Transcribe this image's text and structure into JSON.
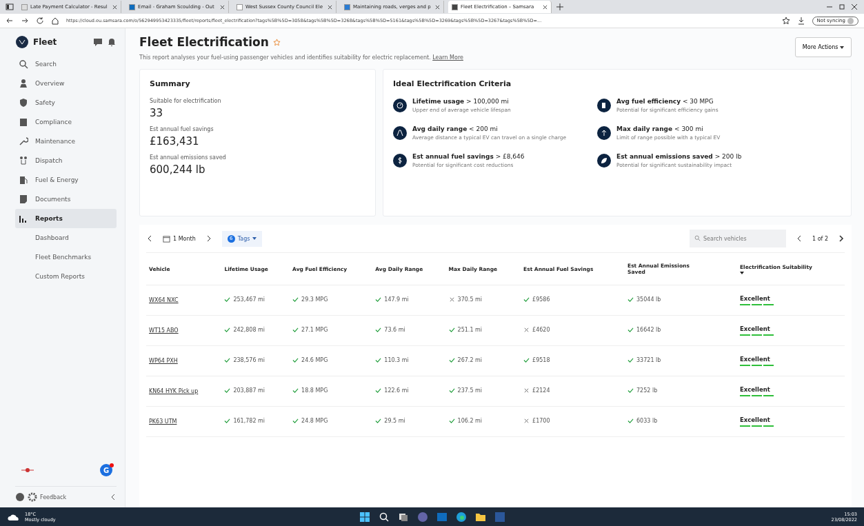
{
  "browser": {
    "tabs": [
      {
        "label": "Late Payment Calculator - Resul",
        "selected": false
      },
      {
        "label": "Email - Graham Scoulding - Out",
        "selected": false
      },
      {
        "label": "West Sussex County Council Ele",
        "selected": false
      },
      {
        "label": "Maintaining roads, verges and p",
        "selected": false
      },
      {
        "label": "Fleet Electrification – Samsara",
        "selected": true
      }
    ],
    "url": "https://cloud.eu.samsara.com/o/562949953423335/fleet/reports/fleet_electrification?tags%5B%5D=3058&tags%5B%5D=3268&tags%5B%5D=5161&tags%5B%5D=3269&tags%5B%5D=3267&tags%5B%5D=...",
    "sync": "Not syncing"
  },
  "sidebar": {
    "title": "Fleet",
    "items": [
      {
        "label": "Search",
        "selected": false
      },
      {
        "label": "Overview",
        "selected": false
      },
      {
        "label": "Safety",
        "selected": false
      },
      {
        "label": "Compliance",
        "selected": false
      },
      {
        "label": "Maintenance",
        "selected": false
      },
      {
        "label": "Dispatch",
        "selected": false
      },
      {
        "label": "Fuel & Energy",
        "selected": false
      },
      {
        "label": "Documents",
        "selected": false
      },
      {
        "label": "Reports",
        "selected": true
      }
    ],
    "subitems": [
      "Dashboard",
      "Fleet Benchmarks",
      "Custom Reports"
    ],
    "avatar": "G",
    "feedback": "Feedback"
  },
  "page": {
    "title": "Fleet Electrification",
    "description": "This report analyses your fuel-using passenger vehicles and identifies suitability for electric replacement.",
    "learn_more": "Learn More",
    "more_actions": "More Actions"
  },
  "summary": {
    "title": "Summary",
    "stats": [
      {
        "label": "Suitable for electrification",
        "value": "33"
      },
      {
        "label": "Est annual fuel savings",
        "value": "£163,431"
      },
      {
        "label": "Est annual emissions saved",
        "value": "600,244 lb"
      }
    ]
  },
  "criteria": {
    "title": "Ideal Electrification Criteria",
    "items": [
      {
        "title": "**Lifetime usage** > 100,000 mi",
        "note": "Upper end of average vehicle lifespan"
      },
      {
        "title": "**Avg fuel efficiency** < 30 MPG",
        "note": "Potential for significant efficiency gains"
      },
      {
        "title": "**Avg daily range** < 200 mi",
        "note": "Average distance a typical EV can travel on a single charge"
      },
      {
        "title": "**Max daily range** < 300 mi",
        "note": "Limit of range possible with a typical EV"
      },
      {
        "title": "**Est annual fuel savings** > £8,646",
        "note": "Potential for significant cost reductions"
      },
      {
        "title": "**Est annual emissions saved** > 200 lb",
        "note": "Potential for significant sustainability impact"
      }
    ]
  },
  "toolbar": {
    "period": "1 Month",
    "tag_count": "6",
    "tags": "Tags",
    "search_placeholder": "Search vehicles",
    "page": "1 of 2"
  },
  "table": {
    "columns": [
      "Vehicle",
      "Lifetime Usage",
      "Avg Fuel Efficiency",
      "Avg Daily Range",
      "Max Daily Range",
      "Est Annual Fuel Savings",
      "Est Annual Emissions Saved",
      "Electrification Suitability"
    ],
    "rows": [
      {
        "cells": [
          {
            "kind": "link",
            "text": "WX64 NXC"
          },
          {
            "text": "253,467 mi",
            "pass": true
          },
          {
            "text": "29.3 MPG",
            "pass": true
          },
          {
            "text": "147.9 mi",
            "pass": true
          },
          {
            "text": "370.5 mi",
            "pass": false
          },
          {
            "text": "£9586",
            "pass": true
          },
          {
            "text": "35044 lb",
            "pass": true
          }
        ],
        "suitability": "Excellent",
        "stars": 3
      },
      {
        "cells": [
          {
            "kind": "link",
            "text": "WT15 ABO"
          },
          {
            "text": "242,808 mi",
            "pass": true
          },
          {
            "text": "27.1 MPG",
            "pass": true
          },
          {
            "text": "73.6 mi",
            "pass": true
          },
          {
            "text": "251.1 mi",
            "pass": true
          },
          {
            "text": "£4620",
            "pass": false
          },
          {
            "text": "16642 lb",
            "pass": true
          }
        ],
        "suitability": "Excellent",
        "stars": 3
      },
      {
        "cells": [
          {
            "kind": "link",
            "text": "WP64 PXH"
          },
          {
            "text": "238,576 mi",
            "pass": true
          },
          {
            "text": "24.6 MPG",
            "pass": true
          },
          {
            "text": "110.3 mi",
            "pass": true
          },
          {
            "text": "267.2 mi",
            "pass": true
          },
          {
            "text": "£9518",
            "pass": true
          },
          {
            "text": "33721 lb",
            "pass": true
          }
        ],
        "suitability": "Excellent",
        "stars": 3
      },
      {
        "cells": [
          {
            "kind": "link",
            "text": "KN64 HYK Pick up"
          },
          {
            "text": "203,887 mi",
            "pass": true
          },
          {
            "text": "18.8 MPG",
            "pass": true
          },
          {
            "text": "122.6 mi",
            "pass": true
          },
          {
            "text": "237.5 mi",
            "pass": true
          },
          {
            "text": "£2124",
            "pass": false
          },
          {
            "text": "7252 lb",
            "pass": true
          }
        ],
        "suitability": "Excellent",
        "stars": 3
      },
      {
        "cells": [
          {
            "kind": "link",
            "text": "PK63 UTM"
          },
          {
            "text": "161,782 mi",
            "pass": true
          },
          {
            "text": "24.8 MPG",
            "pass": true
          },
          {
            "text": "29.5 mi",
            "pass": true
          },
          {
            "text": "106.2 mi",
            "pass": true
          },
          {
            "text": "£1700",
            "pass": false
          },
          {
            "text": "6033 lb",
            "pass": true
          }
        ],
        "suitability": "Excellent",
        "stars": 3
      }
    ]
  },
  "taskbar": {
    "temperature": "18°C",
    "weather": "Mostly cloudy",
    "time": "15:03",
    "date": "23/08/2022"
  }
}
